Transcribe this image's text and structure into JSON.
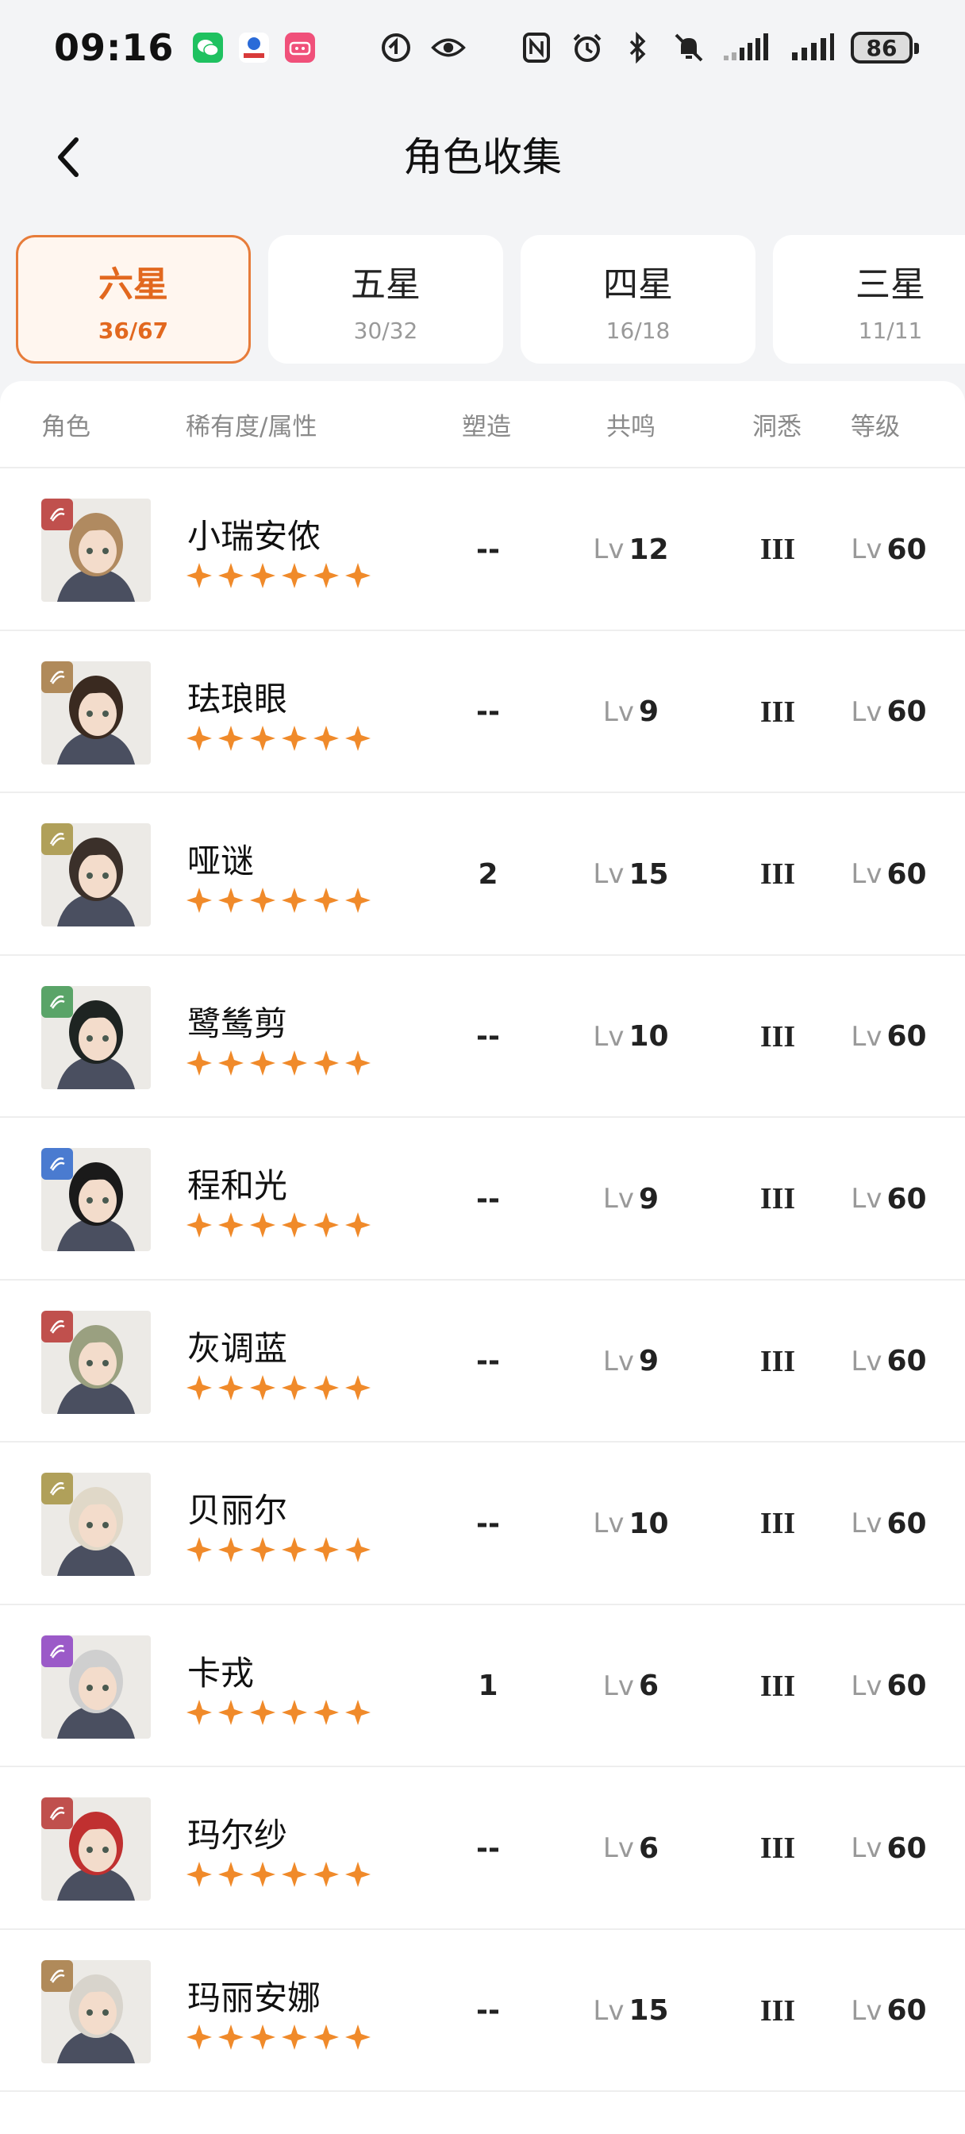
{
  "status_bar": {
    "time": "09:16",
    "battery": "86",
    "icons": [
      "wechat-icon",
      "app-icon",
      "bilibili-icon",
      "circle-icon",
      "eye-icon",
      "nfc-icon",
      "alarm-icon",
      "bluetooth-icon",
      "mute-icon",
      "signal-icon",
      "signal-icon-2"
    ]
  },
  "header": {
    "title": "角色收集"
  },
  "tabs": [
    {
      "label": "六星",
      "count": "36/67"
    },
    {
      "label": "五星",
      "count": "30/32"
    },
    {
      "label": "四星",
      "count": "16/18"
    },
    {
      "label": "三星",
      "count": "11/11"
    }
  ],
  "table": {
    "headers": {
      "character": "角色",
      "rarity": "稀有度/属性",
      "mold": "塑造",
      "resonance": "共鸣",
      "insight": "洞悉",
      "level": "等级"
    },
    "lv_prefix": "Lv",
    "rows": [
      {
        "name": "小瑞安侬",
        "element": "beast-icon",
        "mold": "--",
        "resonance": "12",
        "insight": "III",
        "level": "60"
      },
      {
        "name": "珐琅眼",
        "element": "spirit-icon",
        "mold": "--",
        "resonance": "9",
        "insight": "III",
        "level": "60"
      },
      {
        "name": "哑谜",
        "element": "mineral-icon",
        "mold": "2",
        "resonance": "15",
        "insight": "III",
        "level": "60"
      },
      {
        "name": "鹭鸶剪",
        "element": "plant-icon",
        "mold": "--",
        "resonance": "10",
        "insight": "III",
        "level": "60"
      },
      {
        "name": "程和光",
        "element": "star-icon",
        "mold": "--",
        "resonance": "9",
        "insight": "III",
        "level": "60"
      },
      {
        "name": "灰调蓝",
        "element": "beast-icon",
        "mold": "--",
        "resonance": "9",
        "insight": "III",
        "level": "60"
      },
      {
        "name": "贝丽尔",
        "element": "mineral-icon",
        "mold": "--",
        "resonance": "10",
        "insight": "III",
        "level": "60"
      },
      {
        "name": "卡戎",
        "element": "intellect-icon",
        "mold": "1",
        "resonance": "6",
        "insight": "III",
        "level": "60"
      },
      {
        "name": "玛尔纱",
        "element": "beast-icon",
        "mold": "--",
        "resonance": "6",
        "insight": "III",
        "level": "60"
      },
      {
        "name": "玛丽安娜",
        "element": "spirit-icon",
        "mold": "--",
        "resonance": "15",
        "insight": "III",
        "level": "60"
      }
    ]
  },
  "colors": {
    "accent": "#e77c3a",
    "star": "#f08a2a",
    "beast": "#c0504d",
    "spirit": "#b08a5a",
    "mineral": "#b0a05a",
    "plant": "#5aa468",
    "star_elem": "#4a7bd0",
    "intellect": "#9b5ac8"
  }
}
